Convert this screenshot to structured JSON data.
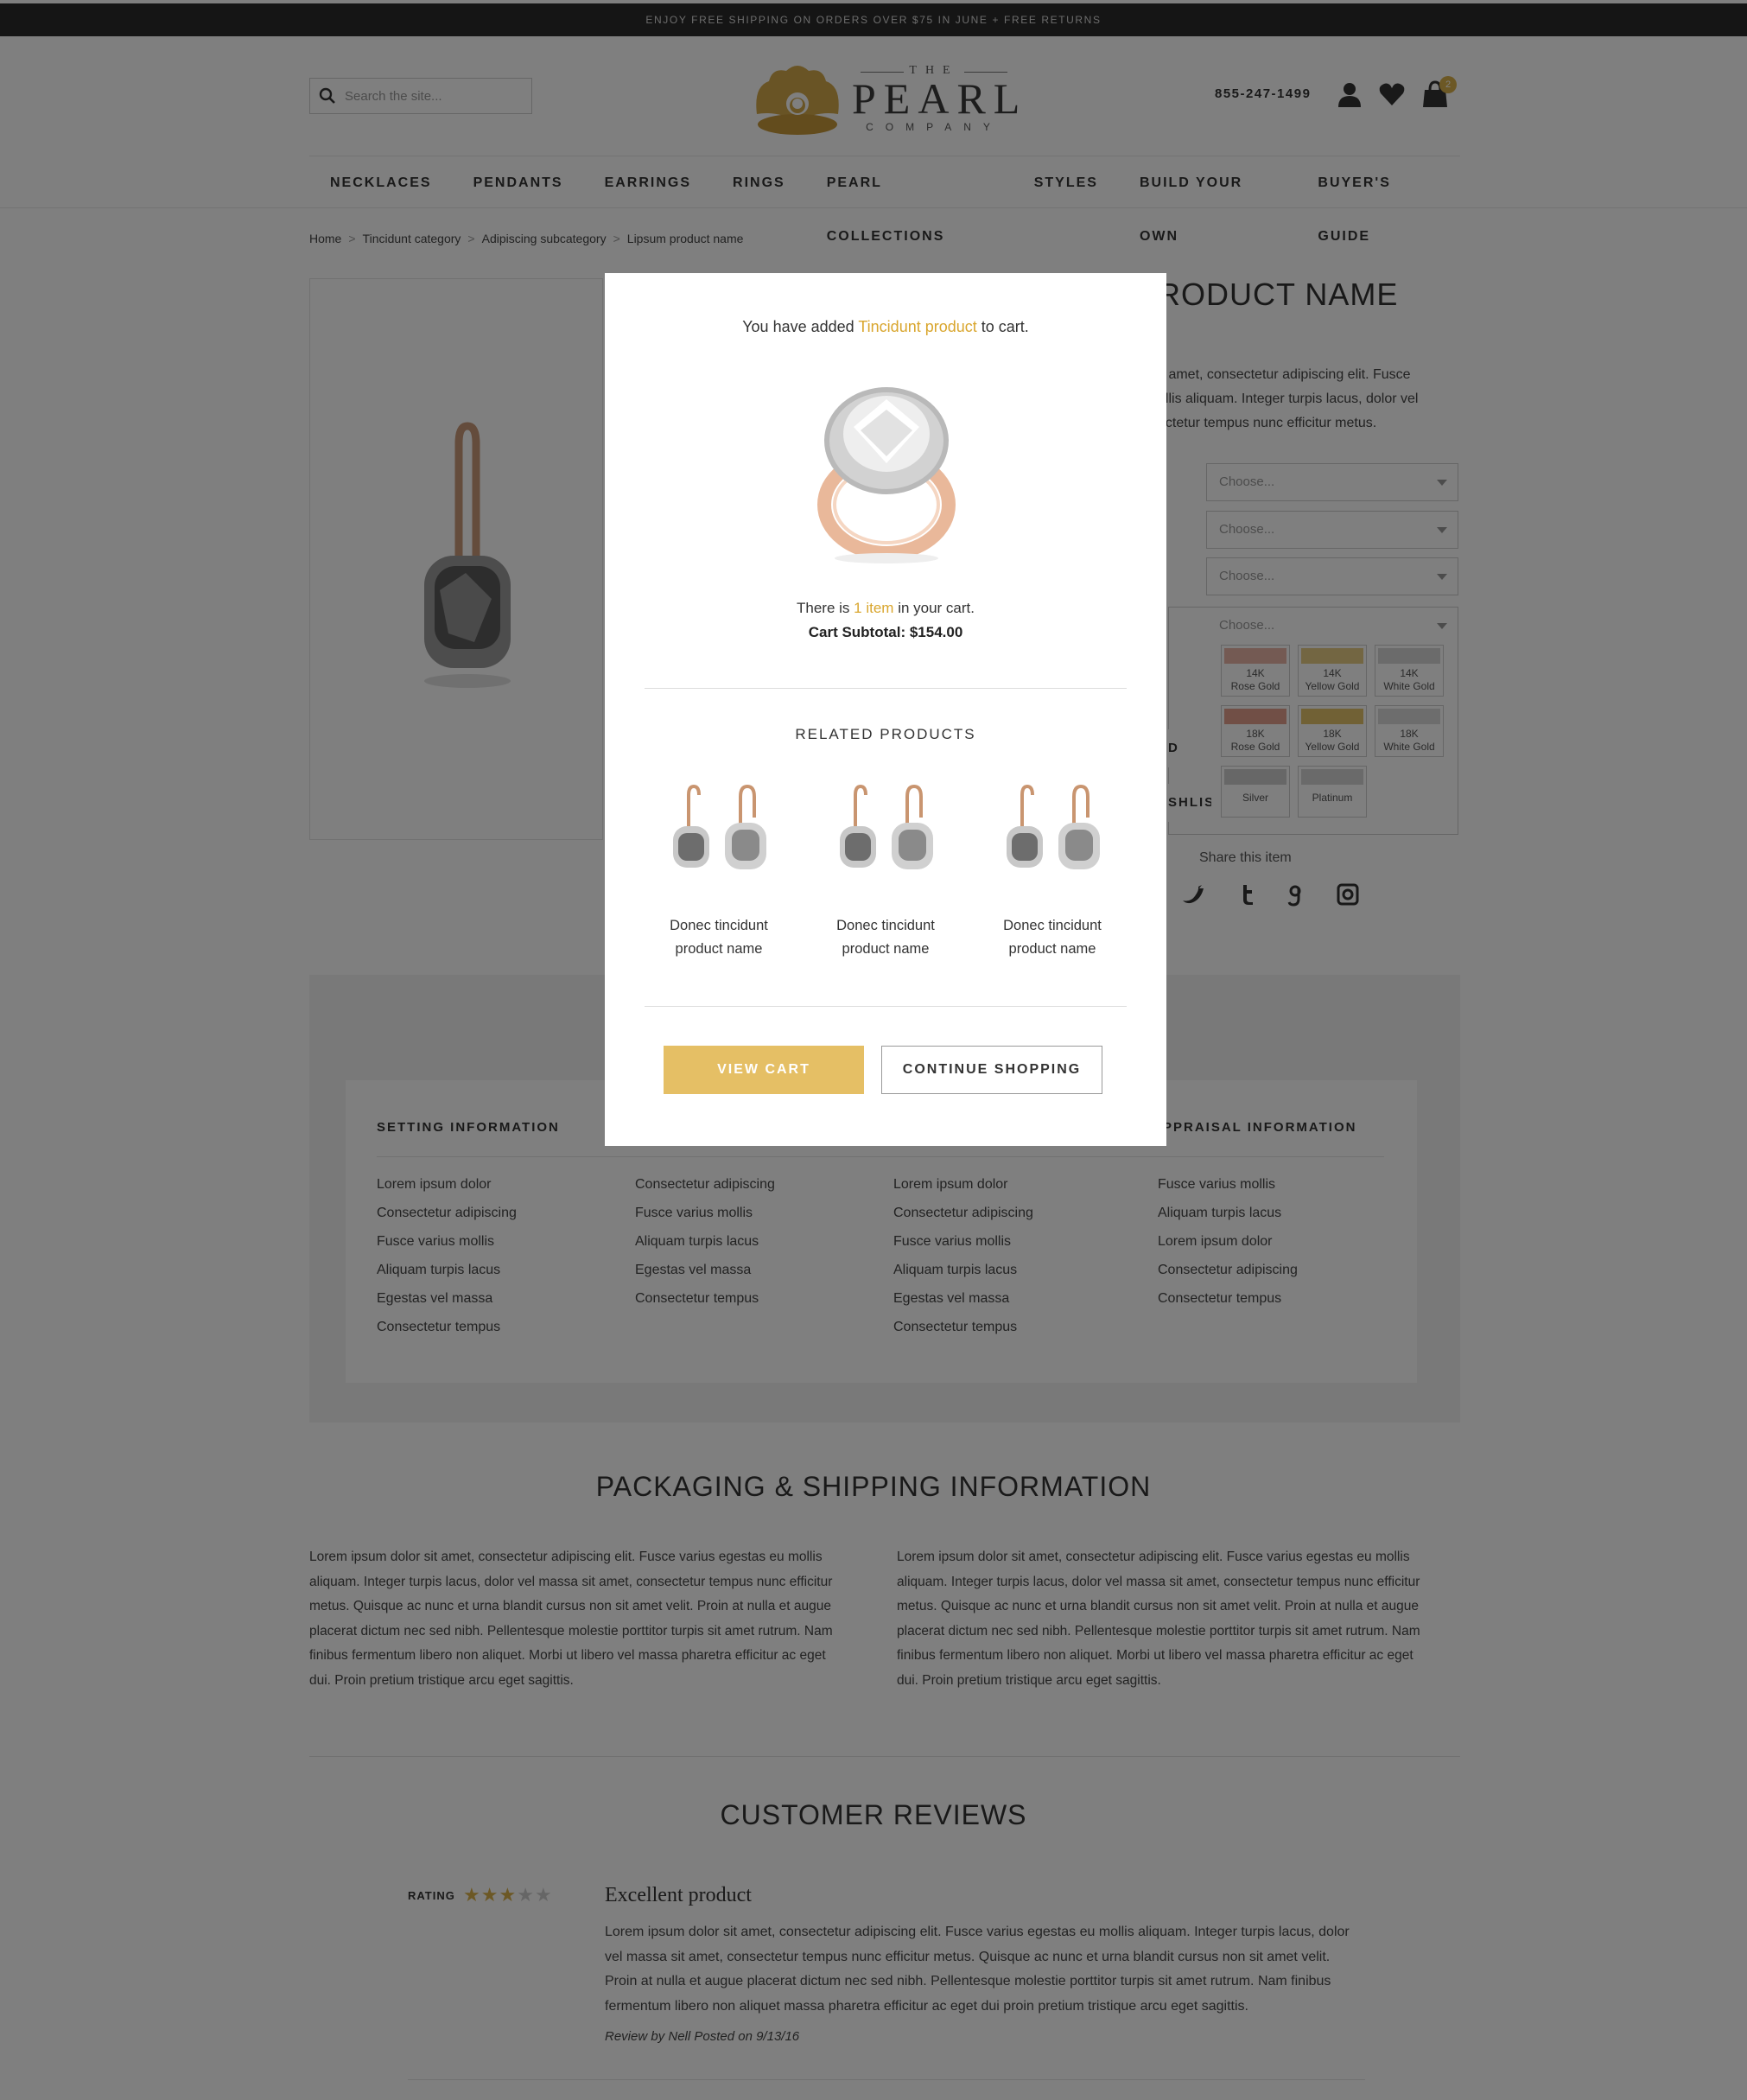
{
  "promo": {
    "text": "ENJOY FREE SHIPPING ON ORDERS OVER $75 IN JUNE + FREE RETURNS"
  },
  "header": {
    "search_placeholder": "Search the site...",
    "logo": {
      "the": "THE",
      "name": "PEARL",
      "company": "COMPANY"
    },
    "phone": "855-247-1499",
    "cart_count": "2",
    "icons": [
      "search-icon",
      "user-icon",
      "heart-icon",
      "shopping-bag-icon"
    ]
  },
  "nav": {
    "items": [
      "NECKLACES",
      "PENDANTS",
      "EARRINGS",
      "RINGS",
      "PEARL COLLECTIONS",
      "STYLES",
      "BUILD YOUR OWN",
      "BUYER'S GUIDE"
    ]
  },
  "breadcrumb": {
    "home": "Home",
    "category": "Tincidunt category",
    "subcategory": "Adipiscing subcategory",
    "product": "Lipsum product name",
    "separator": ">"
  },
  "product": {
    "title_partial": "RODUCT NAME",
    "desc_lines": [
      "it amet, consectetur adipiscing elit. Fusce",
      "ollis aliquam. Integer turpis lacus, dolor vel",
      "ectetur tempus nunc efficitur metus."
    ],
    "select_placeholder": "Choose...",
    "metals": [
      {
        "line1": "14K",
        "line2": "Rose Gold",
        "color": "#e8b4a6"
      },
      {
        "line1": "14K",
        "line2": "Yellow Gold",
        "color": "#e6cc84"
      },
      {
        "line1": "14K",
        "line2": "White Gold",
        "color": "#d6d6d6"
      },
      {
        "line1": "18K",
        "line2": "Rose Gold",
        "color": "#e29f8c"
      },
      {
        "line1": "18K",
        "line2": "Yellow Gold",
        "color": "#e3c26a"
      },
      {
        "line1": "18K",
        "line2": "White Gold",
        "color": "#dadada"
      },
      {
        "line1": "",
        "line2": "Silver",
        "color": "#cfcfcf"
      },
      {
        "line1": "",
        "line2": "Platinum",
        "color": "#d4d4d4"
      }
    ],
    "side_btn1": "D FREE",
    "side_btn2": "SHLIS",
    "share_label": "Share this item",
    "share_icons": [
      "twitter-icon",
      "tumblr-icon",
      "google-icon",
      "instagram-icon"
    ]
  },
  "info": {
    "setting_head": "SETTING INFORMATION",
    "appraisal_head": "PPRAISAL INFORMATION",
    "col1": [
      "Lorem ipsum dolor",
      "Consectetur adipiscing",
      "Fusce varius mollis",
      "Aliquam turpis lacus",
      "Egestas vel massa",
      "Consectetur tempus"
    ],
    "col2": [
      "Consectetur adipiscing",
      "Fusce varius mollis",
      "Aliquam turpis lacus",
      "Egestas vel massa",
      "Consectetur tempus"
    ],
    "col3": [
      "Lorem ipsum dolor",
      "Consectetur adipiscing",
      "Fusce varius mollis",
      "Aliquam turpis lacus",
      "Egestas vel massa",
      "Consectetur tempus"
    ],
    "col4": [
      "Fusce varius mollis",
      "Aliquam turpis lacus",
      "Lorem ipsum dolor",
      "Consectetur adipiscing",
      "Consectetur tempus"
    ]
  },
  "shipping": {
    "title": "PACKAGING & SHIPPING INFORMATION",
    "para_left": "Lorem ipsum dolor sit amet, consectetur adipiscing elit. Fusce varius egestas eu mollis aliquam. Integer turpis lacus, dolor vel massa sit amet, consectetur tempus nunc efficitur metus. Quisque ac nunc et urna blandit cursus non sit amet velit. Proin at nulla et augue placerat dictum nec sed nibh. Pellentesque molestie porttitor turpis sit amet rutrum. Nam finibus fermentum libero non aliquet. Morbi ut libero vel massa pharetra efficitur ac eget dui. Proin pretium tristique arcu eget sagittis.",
    "para_right": "Lorem ipsum dolor sit amet, consectetur adipiscing elit. Fusce varius egestas eu mollis aliquam. Integer turpis lacus, dolor vel massa sit amet, consectetur tempus nunc efficitur metus. Quisque ac nunc et urna blandit cursus non sit amet velit. Proin at nulla et augue placerat dictum nec sed nibh. Pellentesque molestie porttitor turpis sit amet rutrum. Nam finibus fermentum libero non aliquet. Morbi ut libero vel massa pharetra efficitur ac eget dui. Proin pretium tristique arcu eget sagittis."
  },
  "reviews": {
    "title": "CUSTOMER REVIEWS",
    "rating_label": "RATING",
    "rating": 3,
    "rating_max": 5,
    "review_title": "Excellent product",
    "review_body": "Lorem ipsum dolor sit amet, consectetur adipiscing elit. Fusce varius egestas eu mollis aliquam. Integer turpis lacus, dolor vel massa sit amet, consectetur tempus nunc efficitur metus. Quisque ac nunc et urna blandit cursus non sit amet velit. Proin at nulla et augue placerat dictum nec sed nibh. Pellentesque molestie porttitor turpis sit amet rutrum. Nam finibus fermentum libero non aliquet massa pharetra efficitur ac eget dui proin pretium tristique arcu eget sagittis.",
    "review_meta": "Review by Nell Posted on 9/13/16"
  },
  "modal": {
    "added_prefix": "You have added",
    "added_product": "Tincidunt product",
    "added_suffix": "to cart.",
    "count_prefix": "There is",
    "count_item": "1 item",
    "count_suffix": "in your cart.",
    "subtotal": "Cart Subtotal: $154.00",
    "related_title": "RELATED PRODUCTS",
    "related": [
      {
        "line1": "Donec tincidunt",
        "line2": "product name"
      },
      {
        "line1": "Donec tincidunt",
        "line2": "product name"
      },
      {
        "line1": "Donec tincidunt",
        "line2": "product name"
      }
    ],
    "view_cart": "VIEW CART",
    "continue_shopping": "CONTINUE SHOPPING"
  },
  "colors": {
    "accent_gold": "#d9a62e",
    "button_gold": "#e5bf65",
    "promo_bg": "#2a2a2a"
  }
}
